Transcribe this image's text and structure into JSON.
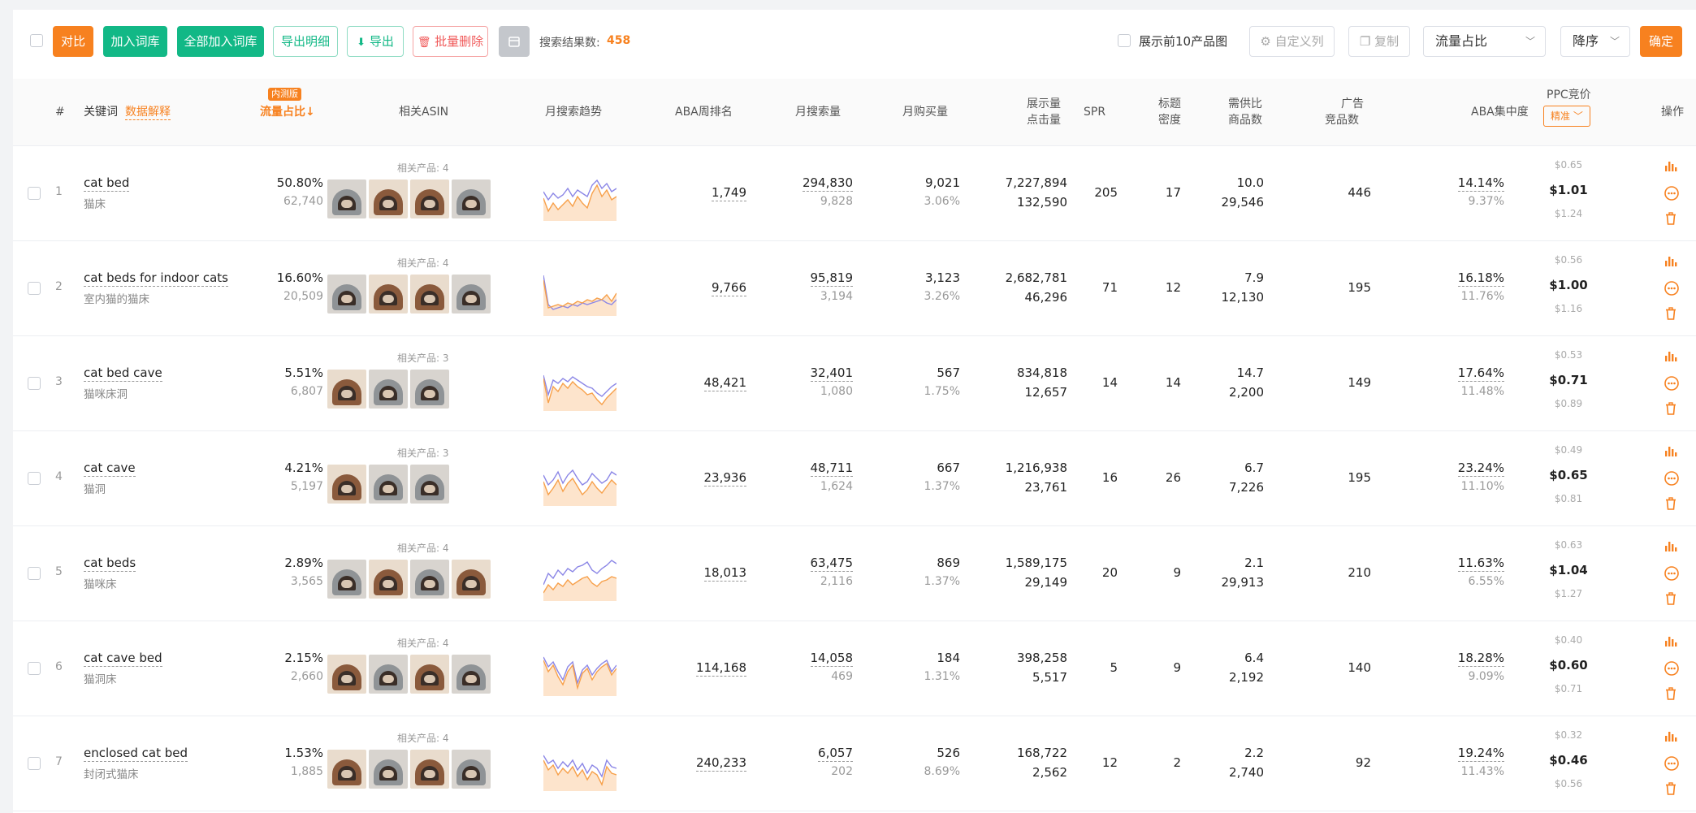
{
  "toolbar": {
    "compare": "对比",
    "add_lib": "加入词库",
    "add_all_lib": "全部加入词库",
    "export_detail": "导出明细",
    "export": "导出",
    "batch_delete": "批量删除",
    "result_label": "搜索结果数:",
    "result_count": "458",
    "show_top10": "展示前10产品图",
    "custom_cols": "自定义列",
    "copy": "复制",
    "sort_field": "流量占比",
    "sort_order": "降序",
    "confirm": "确定"
  },
  "header": {
    "index": "#",
    "keyword": "关键词",
    "data_explain": "数据解释",
    "beta_badge": "内测版",
    "traffic": "流量占比↓",
    "asin": "相关ASIN",
    "trend": "月搜索趋势",
    "aba_rank": "ABA周排名",
    "monthly_search": "月搜索量",
    "monthly_buy": "月购买量",
    "impressions": "展示量",
    "clicks": "点击量",
    "spr": "SPR",
    "title_density_1": "标题",
    "title_density_2": "密度",
    "supply_1": "需供比",
    "supply_2": "商品数",
    "ad_1": "广告",
    "ad_2": "竞品数",
    "aba_conc": "ABA集中度",
    "ppc": "PPC竞价",
    "ppc_mode": "精准",
    "action": "操作"
  },
  "rows": [
    {
      "idx": "1",
      "kw": "cat bed",
      "kw_cn": "猫床",
      "traffic": "50.80%",
      "traffic_sub": "62,740",
      "related": "相关产品: 4",
      "thumbs": [
        "gray",
        "brown",
        "brown",
        "gray"
      ],
      "trend_orange": [
        28,
        12,
        22,
        14,
        20,
        26,
        18,
        30,
        22,
        16,
        34,
        44,
        30,
        38,
        26,
        30
      ],
      "trend_purple": [
        36,
        26,
        34,
        28,
        32,
        40,
        30,
        38,
        34,
        30,
        44,
        50,
        40,
        46,
        36,
        40
      ],
      "aba": "1,749",
      "search": "294,830",
      "search_sub": "9,828",
      "buy": "9,021",
      "buy_sub": "3.06%",
      "imp": "7,227,894",
      "clk": "132,590",
      "spr": "205",
      "density": "17",
      "supply": "10.0",
      "supply_sub": "29,546",
      "ad": "446",
      "conc": "14.14%",
      "conc_sub": "9.37%",
      "ppc_hi": "$0.65",
      "ppc": "$1.01",
      "ppc_lo": "$1.24"
    },
    {
      "idx": "2",
      "kw": "cat beds for indoor cats",
      "kw_cn": "室内猫的猫床",
      "traffic": "16.60%",
      "traffic_sub": "20,509",
      "related": "相关产品: 4",
      "thumbs": [
        "gray",
        "brown",
        "brown",
        "gray"
      ],
      "trend_orange": [
        44,
        10,
        12,
        14,
        12,
        16,
        14,
        18,
        16,
        20,
        18,
        22,
        20,
        26,
        18,
        28
      ],
      "trend_purple": [
        50,
        14,
        8,
        10,
        12,
        10,
        14,
        12,
        16,
        14,
        16,
        18,
        20,
        16,
        14,
        20
      ],
      "aba": "9,766",
      "search": "95,819",
      "search_sub": "3,194",
      "buy": "3,123",
      "buy_sub": "3.26%",
      "imp": "2,682,781",
      "clk": "46,296",
      "spr": "71",
      "density": "12",
      "supply": "7.9",
      "supply_sub": "12,130",
      "ad": "195",
      "conc": "16.18%",
      "conc_sub": "11.76%",
      "ppc_hi": "$0.56",
      "ppc": "$1.00",
      "ppc_lo": "$1.16"
    },
    {
      "idx": "3",
      "kw": "cat bed cave",
      "kw_cn": "猫咪床洞",
      "traffic": "5.51%",
      "traffic_sub": "6,807",
      "related": "相关产品: 3",
      "thumbs": [
        "brown",
        "gray",
        "gray"
      ],
      "trend_orange": [
        40,
        10,
        30,
        24,
        34,
        28,
        36,
        30,
        26,
        20,
        22,
        14,
        8,
        16,
        22,
        28
      ],
      "trend_purple": [
        44,
        20,
        38,
        34,
        40,
        36,
        42,
        38,
        34,
        30,
        28,
        22,
        18,
        24,
        30,
        34
      ],
      "aba": "48,421",
      "search": "32,401",
      "search_sub": "1,080",
      "buy": "567",
      "buy_sub": "1.75%",
      "imp": "834,818",
      "clk": "12,657",
      "spr": "14",
      "density": "14",
      "supply": "14.7",
      "supply_sub": "2,200",
      "ad": "149",
      "conc": "17.64%",
      "conc_sub": "11.48%",
      "ppc_hi": "$0.53",
      "ppc": "$0.71",
      "ppc_lo": "$0.89"
    },
    {
      "idx": "4",
      "kw": "cat cave",
      "kw_cn": "猫洞",
      "traffic": "4.21%",
      "traffic_sub": "5,197",
      "related": "相关产品: 3",
      "thumbs": [
        "brown",
        "gray",
        "gray"
      ],
      "trend_orange": [
        30,
        14,
        22,
        32,
        18,
        28,
        34,
        24,
        14,
        20,
        30,
        22,
        16,
        24,
        32,
        26
      ],
      "trend_purple": [
        38,
        26,
        32,
        42,
        28,
        38,
        44,
        34,
        26,
        30,
        40,
        34,
        28,
        32,
        42,
        38
      ],
      "aba": "23,936",
      "search": "48,711",
      "search_sub": "1,624",
      "buy": "667",
      "buy_sub": "1.37%",
      "imp": "1,216,938",
      "clk": "23,761",
      "spr": "16",
      "density": "26",
      "supply": "6.7",
      "supply_sub": "7,226",
      "ad": "195",
      "conc": "23.24%",
      "conc_sub": "11.10%",
      "ppc_hi": "$0.49",
      "ppc": "$0.65",
      "ppc_lo": "$0.81"
    },
    {
      "idx": "5",
      "kw": "cat beds",
      "kw_cn": "猫咪床",
      "traffic": "2.89%",
      "traffic_sub": "3,565",
      "related": "相关产品: 4",
      "thumbs": [
        "gray",
        "brown",
        "gray",
        "brown"
      ],
      "trend_orange": [
        10,
        20,
        14,
        22,
        18,
        26,
        20,
        24,
        28,
        30,
        22,
        18,
        24,
        26,
        30,
        28
      ],
      "trend_purple": [
        20,
        34,
        28,
        38,
        32,
        40,
        36,
        42,
        44,
        48,
        38,
        34,
        40,
        44,
        50,
        46
      ],
      "aba": "18,013",
      "search": "63,475",
      "search_sub": "2,116",
      "buy": "869",
      "buy_sub": "1.37%",
      "imp": "1,589,175",
      "clk": "29,149",
      "spr": "20",
      "density": "9",
      "supply": "2.1",
      "supply_sub": "29,913",
      "ad": "210",
      "conc": "11.63%",
      "conc_sub": "6.55%",
      "ppc_hi": "$0.63",
      "ppc": "$1.04",
      "ppc_lo": "$1.27"
    },
    {
      "idx": "6",
      "kw": "cat cave bed",
      "kw_cn": "猫洞床",
      "traffic": "2.15%",
      "traffic_sub": "2,660",
      "related": "相关产品: 4",
      "thumbs": [
        "brown",
        "gray",
        "brown",
        "gray"
      ],
      "trend_orange": [
        44,
        30,
        38,
        24,
        14,
        30,
        38,
        10,
        28,
        34,
        20,
        30,
        36,
        40,
        26,
        34
      ],
      "trend_purple": [
        48,
        36,
        42,
        30,
        20,
        36,
        42,
        16,
        32,
        38,
        26,
        34,
        40,
        44,
        30,
        38
      ],
      "aba": "114,168",
      "search": "14,058",
      "search_sub": "469",
      "buy": "184",
      "buy_sub": "1.31%",
      "imp": "398,258",
      "clk": "5,517",
      "spr": "5",
      "density": "9",
      "supply": "6.4",
      "supply_sub": "2,192",
      "ad": "140",
      "conc": "18.28%",
      "conc_sub": "9.09%",
      "ppc_hi": "$0.40",
      "ppc": "$0.60",
      "ppc_lo": "$0.71"
    },
    {
      "idx": "7",
      "kw": "enclosed cat bed",
      "kw_cn": "封闭式猫床",
      "traffic": "1.53%",
      "traffic_sub": "1,885",
      "related": "相关产品: 4",
      "thumbs": [
        "brown",
        "gray",
        "brown",
        "gray"
      ],
      "trend_orange": [
        38,
        26,
        32,
        20,
        28,
        22,
        30,
        18,
        26,
        14,
        24,
        20,
        8,
        30,
        22,
        20
      ],
      "trend_purple": [
        44,
        34,
        38,
        28,
        36,
        30,
        38,
        26,
        34,
        22,
        32,
        28,
        18,
        38,
        30,
        28
      ],
      "aba": "240,233",
      "search": "6,057",
      "search_sub": "202",
      "buy": "526",
      "buy_sub": "8.69%",
      "imp": "168,722",
      "clk": "2,562",
      "spr": "12",
      "density": "2",
      "supply": "2.2",
      "supply_sub": "2,740",
      "ad": "92",
      "conc": "19.24%",
      "conc_sub": "11.43%",
      "ppc_hi": "$0.32",
      "ppc": "$0.46",
      "ppc_lo": "$0.56"
    }
  ],
  "colors": {
    "orange": "#f7811f",
    "teal": "#12b886",
    "red": "#f05a5a",
    "trend_orange": "#f7a04a",
    "trend_purple": "#8b86e6",
    "trend_fill": "#fde4cc"
  }
}
